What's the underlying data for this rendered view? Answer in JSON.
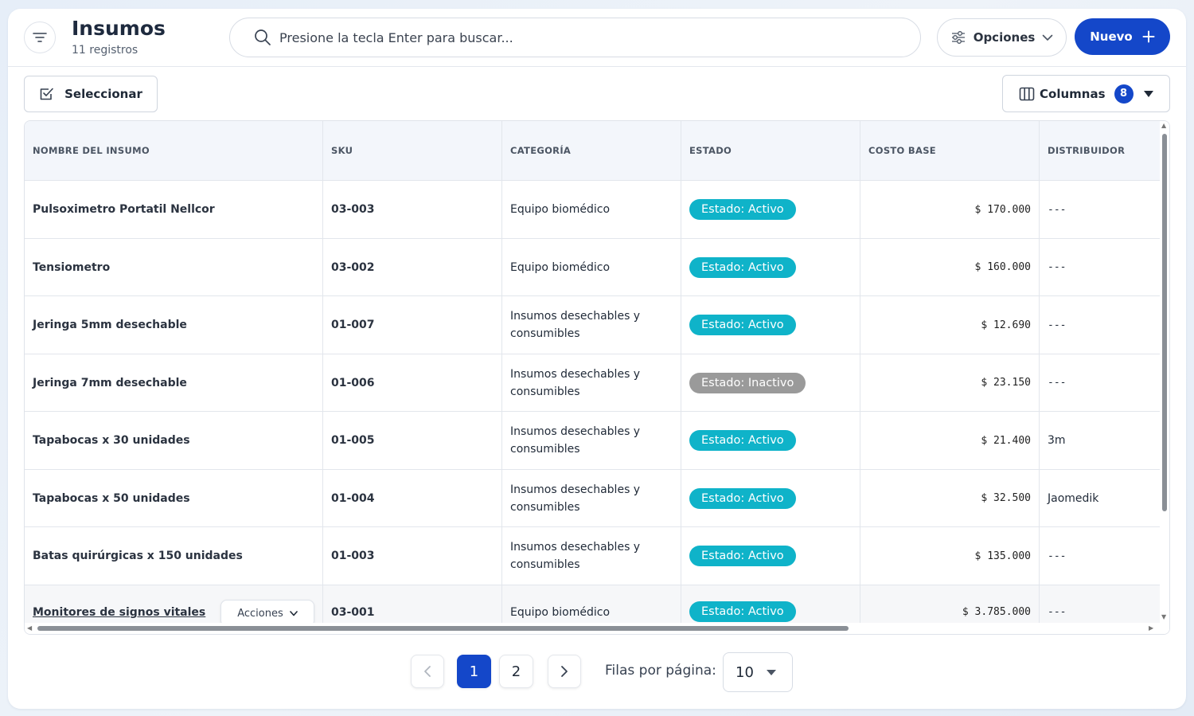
{
  "header": {
    "title": "Insumos",
    "subtitle": "11 registros",
    "search_placeholder": "Presione la tecla Enter para buscar...",
    "options_label": "Opciones",
    "new_label": "Nuevo"
  },
  "toolbar": {
    "select_label": "Seleccionar",
    "columns_label": "Columnas",
    "columns_count": "8"
  },
  "table": {
    "columns": [
      "NOMBRE DEL INSUMO",
      "SKU",
      "CATEGORÍA",
      "ESTADO",
      "COSTO BASE",
      "DISTRIBUIDOR"
    ],
    "rows": [
      {
        "name": "Pulsoximetro Portatil Nellcor",
        "sku": "03-003",
        "category": "Equipo biomédico",
        "status": "Estado: Activo",
        "cost": "$ 170.000",
        "distributor": "---"
      },
      {
        "name": "Tensiometro",
        "sku": "03-002",
        "category": "Equipo biomédico",
        "status": "Estado: Activo",
        "cost": "$ 160.000",
        "distributor": "---"
      },
      {
        "name": "Jeringa 5mm desechable",
        "sku": "01-007",
        "category": "Insumos desechables y consumibles",
        "status": "Estado: Activo",
        "cost": "$ 12.690",
        "distributor": "---"
      },
      {
        "name": "Jeringa 7mm desechable",
        "sku": "01-006",
        "category": "Insumos desechables y consumibles",
        "status": "Estado: Inactivo",
        "cost": "$ 23.150",
        "distributor": "---"
      },
      {
        "name": "Tapabocas x 30 unidades",
        "sku": "01-005",
        "category": "Insumos desechables y consumibles",
        "status": "Estado: Activo",
        "cost": "$ 21.400",
        "distributor": "3m"
      },
      {
        "name": "Tapabocas x 50 unidades",
        "sku": "01-004",
        "category": "Insumos desechables y consumibles",
        "status": "Estado: Activo",
        "cost": "$ 32.500",
        "distributor": "Jaomedik"
      },
      {
        "name": "Batas quirúrgicas x 150 unidades",
        "sku": "01-003",
        "category": "Insumos desechables y consumibles",
        "status": "Estado: Activo",
        "cost": "$ 135.000",
        "distributor": "---"
      },
      {
        "name": "Monitores de signos vitales",
        "sku": "03-001",
        "category": "Equipo biomédico",
        "status": "Estado: Activo",
        "cost": "$ 3.785.000",
        "distributor": "---"
      }
    ],
    "row_actions_label": "Acciones"
  },
  "pagination": {
    "pages": [
      "1",
      "2"
    ],
    "current_page": "1",
    "rows_per_page_label": "Filas por página:",
    "rows_per_page_value": "10"
  },
  "colors": {
    "primary": "#1447c9",
    "status_active": "#0fb3c9",
    "status_inactive": "#9a9a9a",
    "header_bg": "#f3f6fb"
  }
}
